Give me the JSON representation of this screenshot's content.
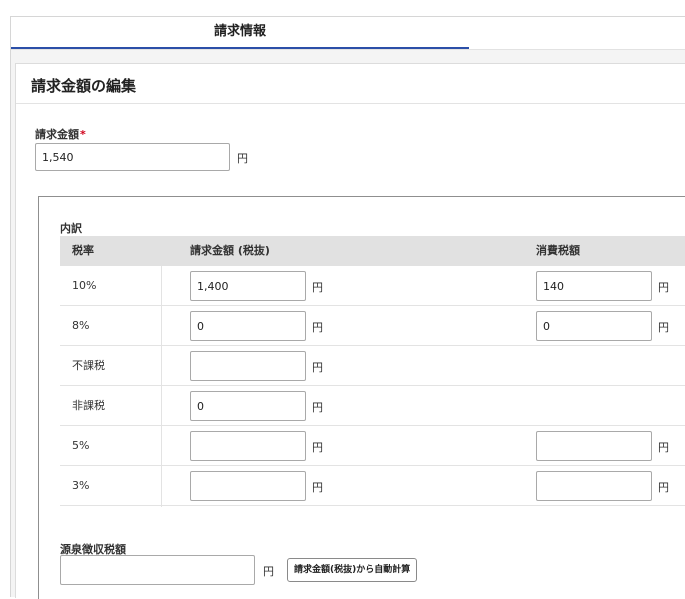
{
  "tabs": {
    "active_label": "請求情報"
  },
  "card": {
    "title": "請求金額の編集"
  },
  "amount": {
    "label": "請求金額",
    "required_mark": "*",
    "value": "1,540",
    "unit": "円"
  },
  "breakdown": {
    "label": "内訳",
    "headers": {
      "rate": "税率",
      "amount_ex_tax": "請求金額 (税抜)",
      "tax": "消費税額"
    },
    "unit": "円",
    "rows": [
      {
        "rate": "10%",
        "amount": "1,400",
        "tax": "140",
        "has_tax": true
      },
      {
        "rate": "8%",
        "amount": "0",
        "tax": "0",
        "has_tax": true
      },
      {
        "rate": "不課税",
        "amount": "",
        "tax": "",
        "has_tax": false
      },
      {
        "rate": "非課税",
        "amount": "0",
        "tax": "",
        "has_tax": false
      },
      {
        "rate": "5%",
        "amount": "",
        "tax": "",
        "has_tax": true
      },
      {
        "rate": "3%",
        "amount": "",
        "tax": "",
        "has_tax": true
      }
    ]
  },
  "withholding": {
    "label": "源泉徴収税額",
    "value": "",
    "unit": "円",
    "auto_calc_button": "請求金額(税抜)から自動計算"
  }
}
